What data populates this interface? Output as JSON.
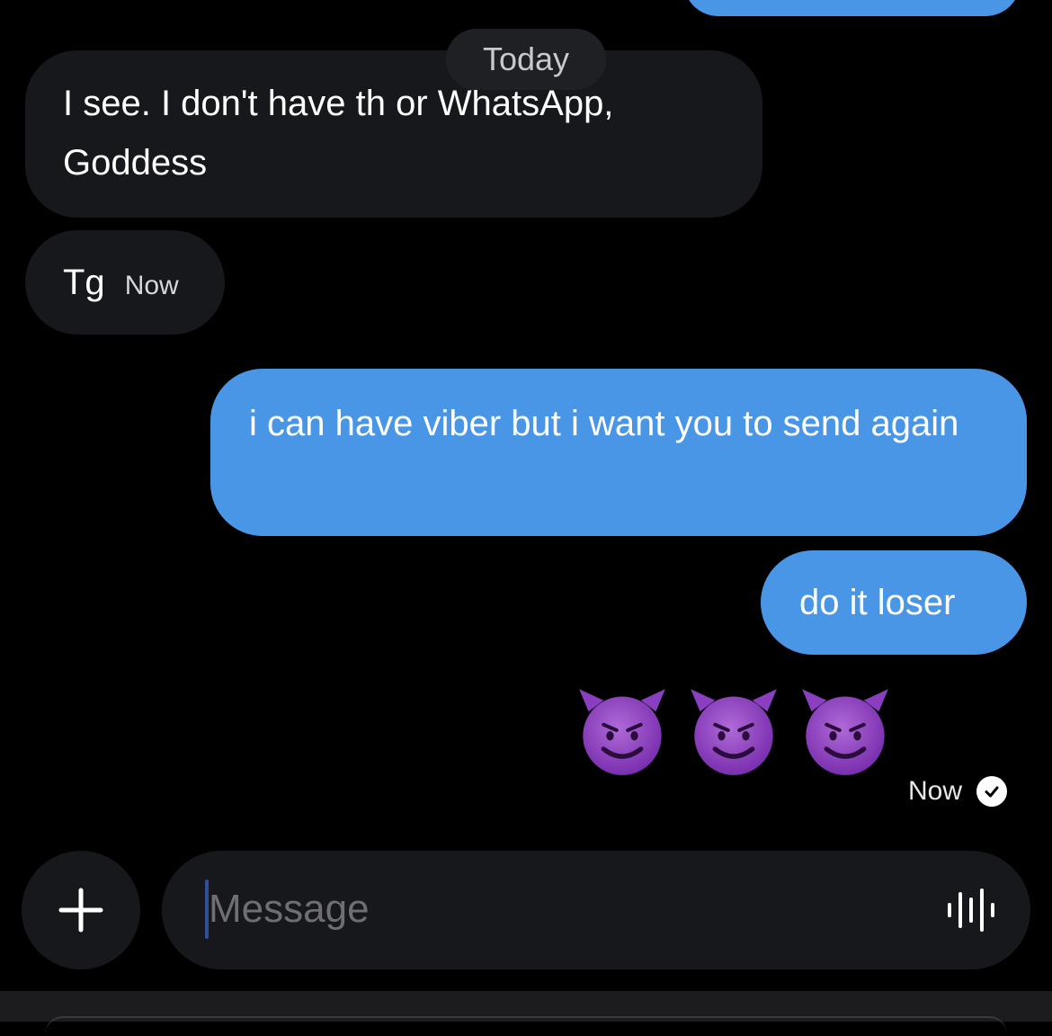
{
  "conversation": {
    "date_separator": "Today",
    "messages": [
      {
        "direction": "incoming",
        "text": "I see. I don't have th or WhatsApp, Goddess"
      },
      {
        "direction": "incoming",
        "text": "Tg",
        "timestamp": "Now"
      },
      {
        "direction": "outgoing",
        "text": "i can have viber but i want you to send again"
      },
      {
        "direction": "outgoing",
        "text": "do it loser"
      },
      {
        "direction": "outgoing",
        "emoji": "😈😈😈",
        "emoji_name": "smiling-face-with-horns",
        "count": 3
      }
    ],
    "last_status": {
      "timestamp": "Now",
      "state": "read",
      "icon": "check-circle-icon"
    }
  },
  "composer": {
    "add_icon": "plus-icon",
    "placeholder": "Message",
    "voice_icon": "waveform-icon"
  },
  "colors": {
    "background": "#000000",
    "incoming_bubble": "#17181b",
    "outgoing_bubble": "#4a96e6",
    "accent_caret": "#2f4f9a"
  }
}
